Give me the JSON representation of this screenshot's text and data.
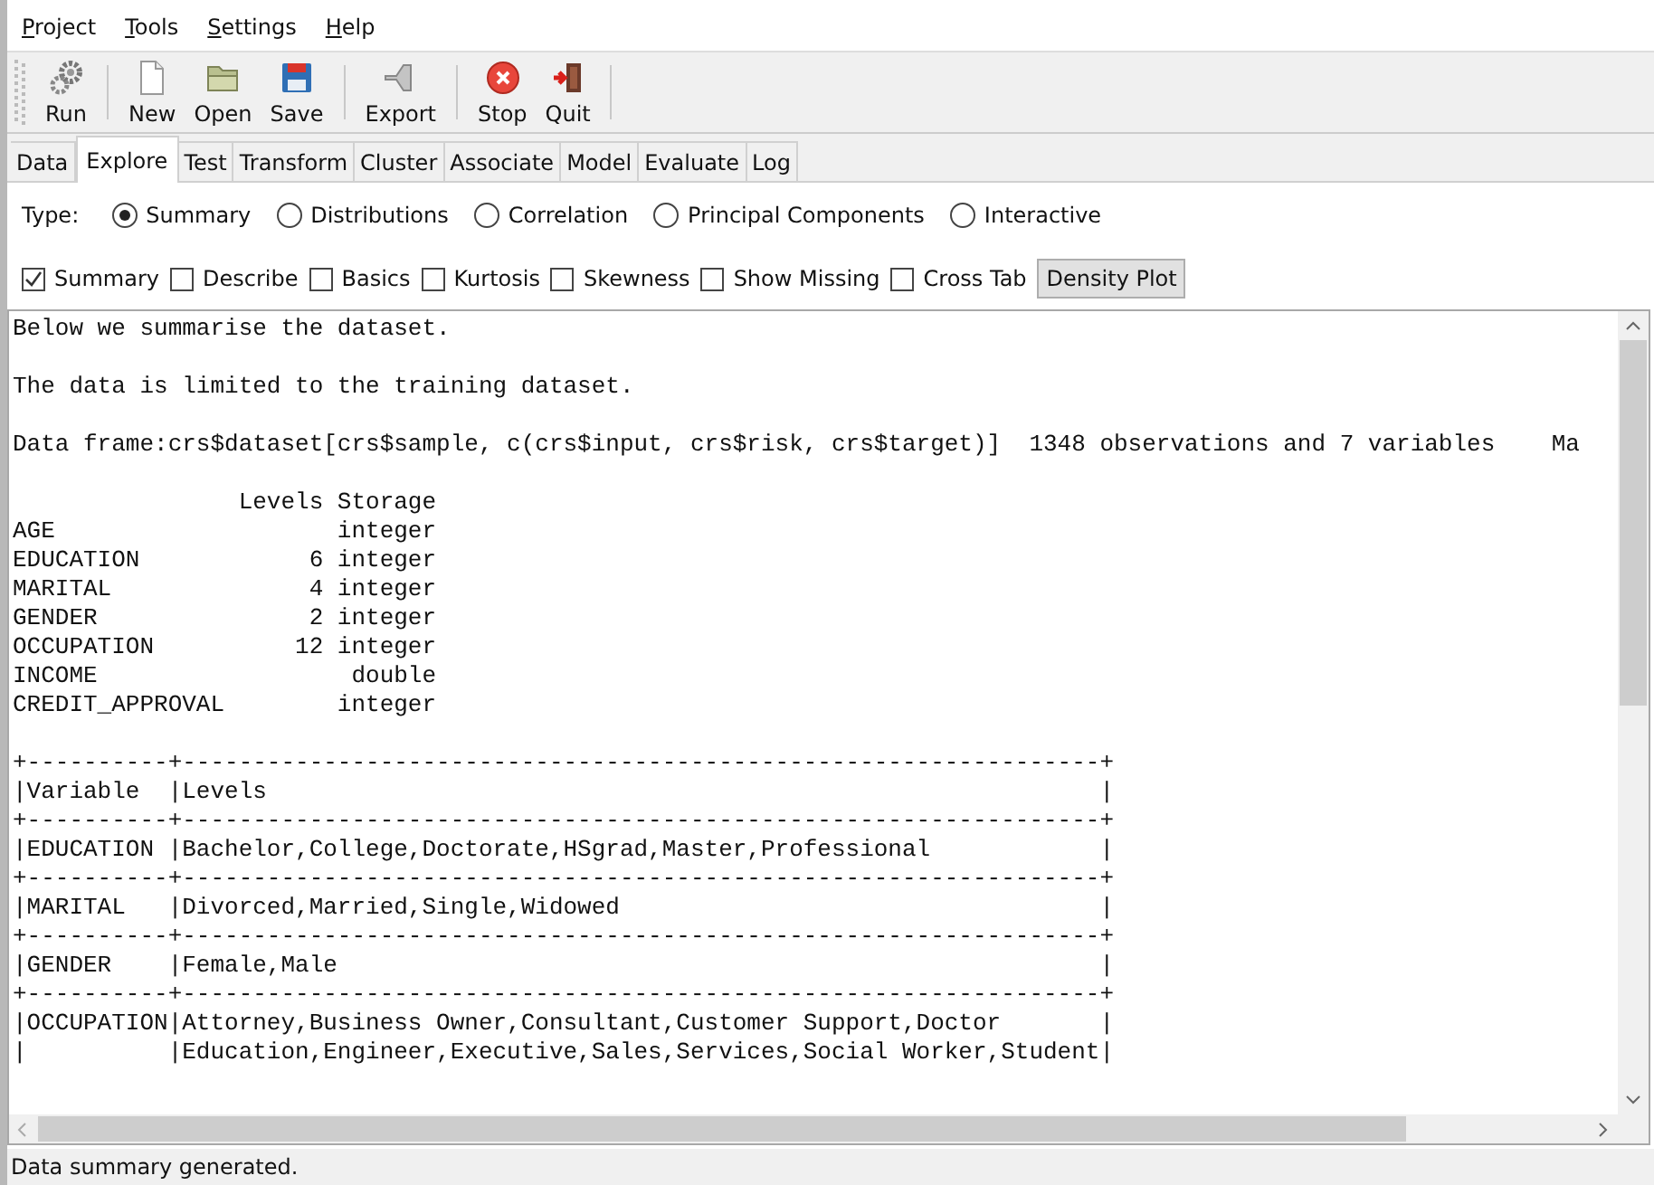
{
  "menu": [
    "Project",
    "Tools",
    "Settings",
    "Help"
  ],
  "toolbar": [
    [
      "Run"
    ],
    [
      "New",
      "Open",
      "Save"
    ],
    [
      "Export"
    ],
    [
      "Stop",
      "Quit"
    ]
  ],
  "tabs": [
    {
      "label": "Data",
      "selected": false
    },
    {
      "label": "Explore",
      "selected": true
    },
    {
      "label": "Test",
      "selected": false
    },
    {
      "label": "Transform",
      "selected": false
    },
    {
      "label": "Cluster",
      "selected": false
    },
    {
      "label": "Associate",
      "selected": false
    },
    {
      "label": "Model",
      "selected": false
    },
    {
      "label": "Evaluate",
      "selected": false
    },
    {
      "label": "Log",
      "selected": false
    }
  ],
  "type": {
    "label": "Type:",
    "options": [
      {
        "label": "Summary",
        "selected": true
      },
      {
        "label": "Distributions",
        "selected": false
      },
      {
        "label": "Correlation",
        "selected": false
      },
      {
        "label": "Principal Components",
        "selected": false
      },
      {
        "label": "Interactive",
        "selected": false
      }
    ]
  },
  "checkboxes": [
    {
      "label": "Summary",
      "checked": true
    },
    {
      "label": "Describe",
      "checked": false
    },
    {
      "label": "Basics",
      "checked": false
    },
    {
      "label": "Kurtosis",
      "checked": false
    },
    {
      "label": "Skewness",
      "checked": false
    },
    {
      "label": "Show Missing",
      "checked": false
    },
    {
      "label": "Cross Tab",
      "checked": false
    }
  ],
  "density_button": "Density Plot",
  "output": [
    {
      "lines": [
        "Below we summarise the dataset."
      ]
    },
    {
      "lines": [
        "The data is limited to the training dataset."
      ]
    },
    {
      "lines": [
        "Data frame:crs$dataset[crs$sample, c(crs$input, crs$risk, crs$target)]  1348 observations and 7 variables    Ma"
      ]
    },
    {
      "lines": [
        "                Levels Storage",
        "AGE                    integer",
        "EDUCATION            6 integer",
        "MARITAL              4 integer",
        "GENDER               2 integer",
        "OCCUPATION          12 integer",
        "INCOME                  double",
        "CREDIT_APPROVAL        integer"
      ]
    },
    {
      "lines": [
        "+----------+-----------------------------------------------------------------+",
        "|Variable  |Levels                                                           |",
        "+----------+-----------------------------------------------------------------+",
        "|EDUCATION |Bachelor,College,Doctorate,HSgrad,Master,Professional            |",
        "+----------+-----------------------------------------------------------------+",
        "|MARITAL   |Divorced,Married,Single,Widowed                                  |",
        "+----------+-----------------------------------------------------------------+",
        "|GENDER    |Female,Male                                                      |",
        "+----------+-----------------------------------------------------------------+",
        "|OCCUPATION|Attorney,Business Owner,Consultant,Customer Support,Doctor       |",
        "|          |Education,Engineer,Executive,Sales,Services,Social Worker,Student|"
      ]
    }
  ],
  "status_bar": "Data summary generated."
}
